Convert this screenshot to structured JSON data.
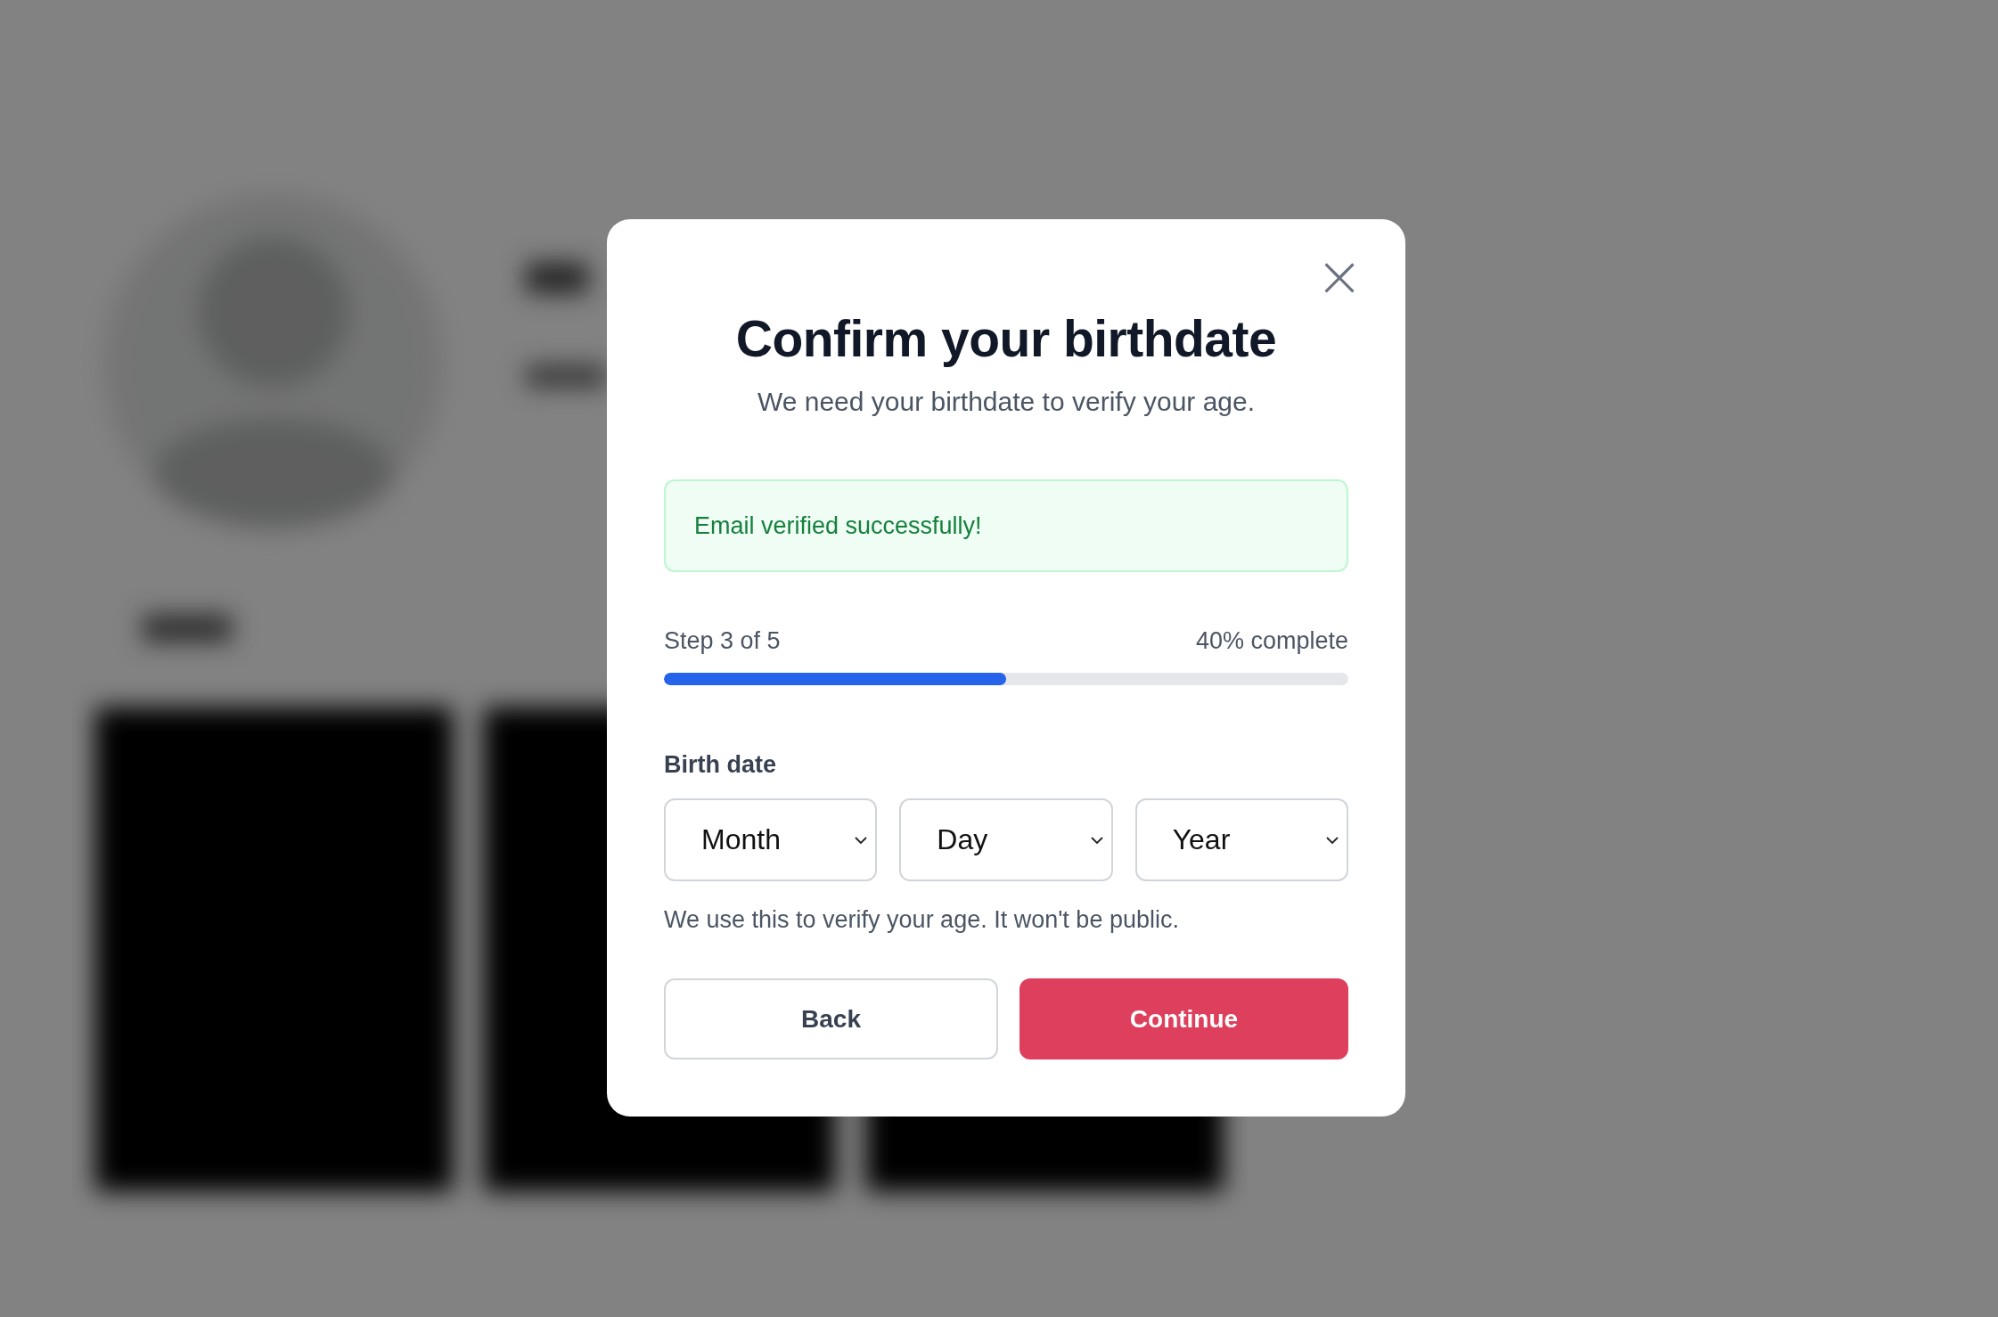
{
  "dialog": {
    "close": "×",
    "title": "Confirm your birthdate",
    "subtitle": "We need your birthdate to verify your age.",
    "alert": {
      "kind": "success",
      "text": "Email verified successfully!"
    },
    "progress": {
      "step": "Step 3 of 5",
      "percent": "40% complete",
      "level": 0.5
    },
    "field_label": "Birth date",
    "selects": [
      {
        "placeholder": "Month"
      },
      {
        "placeholder": "Day"
      },
      {
        "placeholder": "Year"
      }
    ],
    "help": "We use this to verify your age. It won't be public.",
    "buttons": [
      {
        "label": "Back",
        "kind": "secondary"
      },
      {
        "label": "Continue",
        "kind": "primary"
      }
    ]
  }
}
